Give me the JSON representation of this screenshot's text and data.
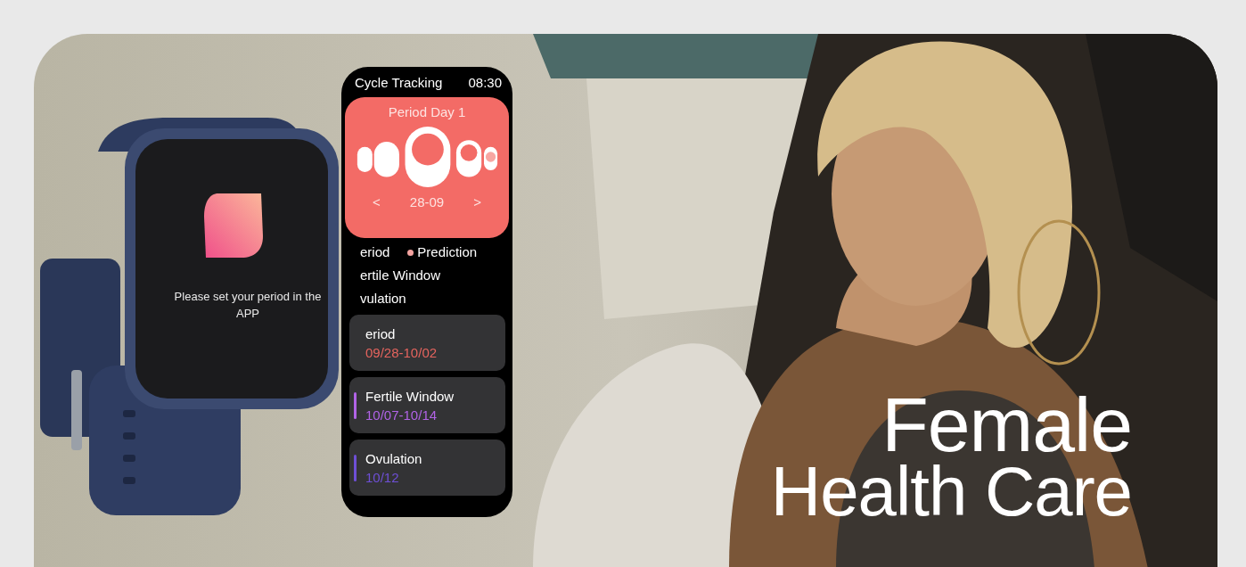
{
  "banner": {
    "watch_message": "Please set your period in the APP",
    "app": {
      "title": "Cycle Tracking",
      "time": "08:30",
      "status": {
        "label": "Period Day 1",
        "prev": "<",
        "date": "28-09",
        "next": ">"
      },
      "legend": [
        [
          {
            "label": "eriod",
            "kind": "plain"
          },
          {
            "label": "Prediction",
            "kind": "dot",
            "color": "#f4a3a0"
          }
        ],
        [
          {
            "label": "ertile Window",
            "kind": "plain"
          }
        ],
        [
          {
            "label": "vulation",
            "kind": "plain"
          }
        ]
      ],
      "cards": [
        {
          "title": "eriod",
          "dates": "09/28-10/02",
          "color": "#e5645e",
          "bar": false
        },
        {
          "title": "Fertile Window",
          "dates": "10/07-10/14",
          "color": "#b163e6",
          "bar": true
        },
        {
          "title": "Ovulation",
          "dates": "10/12",
          "color": "#6e4fd6",
          "bar": true
        }
      ]
    },
    "headline": [
      "Female",
      "Health Care"
    ]
  }
}
